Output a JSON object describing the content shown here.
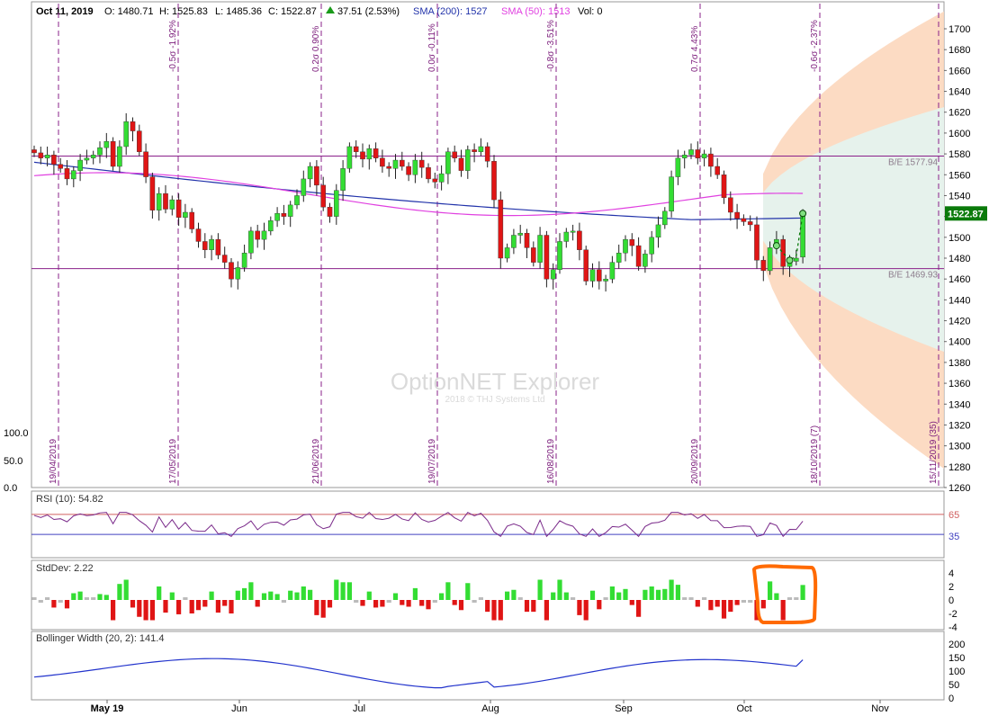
{
  "header": {
    "date": "Oct 11, 2019",
    "open": "O: 1480.71",
    "high": "H: 1525.83",
    "low": "L: 1485.36",
    "close": "C: 1522.87",
    "change": "37.51 (2.53%)",
    "sma200": "SMA (200): 1527",
    "sma50": "SMA (50): 1513",
    "vol": "Vol: 0"
  },
  "watermark": {
    "title": "OptionNET Explorer",
    "copyright": "2018 © THJ Systems Ltd"
  },
  "colors": {
    "up": "#33dd33",
    "down": "#e01515",
    "sma200": "#2233aa",
    "sma50": "#e040e0",
    "cone_outer": "#fbd5b8",
    "cone_inner": "#e5f3ee",
    "expiry": "#8a208a",
    "highlight": "#ff6a00"
  },
  "chart_data": [
    {
      "type": "candlestick",
      "name": "price",
      "y_ticks": [
        "1700",
        "1680",
        "1660",
        "1640",
        "1620",
        "1600",
        "1580",
        "1560",
        "1540",
        "1520",
        "1500",
        "1480",
        "1460",
        "1440",
        "1420",
        "1400",
        "1380",
        "1360",
        "1340",
        "1320",
        "1300",
        "1280",
        "1260"
      ],
      "ylim": [
        1260,
        1710
      ],
      "x_month_labels": [
        "May 19",
        "Jun",
        "Jul",
        "Aug",
        "Sep",
        "Oct",
        "Nov"
      ],
      "last_price_label": "1522.87",
      "breakeven_lines": [
        {
          "label": "B/E 1577.94",
          "value": 1577.94
        },
        {
          "label": "B/E 1469.93",
          "value": 1469.93
        }
      ],
      "expirations": [
        {
          "date": "19/04/2019",
          "move": ""
        },
        {
          "date": "17/05/2019",
          "move": "-0.5σ -1.92%"
        },
        {
          "date": "21/06/2019",
          "move": "0.2σ 0.90%"
        },
        {
          "date": "19/07/2019",
          "move": "0.0σ -0.11%"
        },
        {
          "date": "16/08/2019",
          "move": "-0.8σ -3.51%"
        },
        {
          "date": "20/09/2019",
          "move": "0.7σ 4.43%"
        },
        {
          "date": "18/10/2019 (7)",
          "move": "-0.6σ -2.37%"
        },
        {
          "date": "15/11/2019 (35)",
          "move": ""
        }
      ],
      "left_scale_labels": [
        "100.0",
        "50.0",
        "0.0"
      ],
      "closes": [
        1581,
        1576,
        1579,
        1570,
        1566,
        1556,
        1564,
        1574,
        1576,
        1579,
        1586,
        1592,
        1568,
        1587,
        1611,
        1602,
        1582,
        1558,
        1526,
        1542,
        1527,
        1536,
        1519,
        1524,
        1508,
        1496,
        1488,
        1498,
        1483,
        1476,
        1460,
        1471,
        1485,
        1506,
        1498,
        1506,
        1516,
        1523,
        1520,
        1531,
        1540,
        1556,
        1568,
        1550,
        1529,
        1520,
        1545,
        1566,
        1587,
        1582,
        1575,
        1585,
        1576,
        1568,
        1566,
        1574,
        1568,
        1560,
        1574,
        1567,
        1556,
        1553,
        1561,
        1582,
        1576,
        1564,
        1584,
        1582,
        1587,
        1573,
        1536,
        1480,
        1490,
        1502,
        1504,
        1490,
        1476,
        1502,
        1460,
        1469,
        1496,
        1505,
        1506,
        1488,
        1458,
        1469,
        1458,
        1460,
        1476,
        1485,
        1498,
        1492,
        1472,
        1484,
        1500,
        1512,
        1525,
        1558,
        1576,
        1579,
        1584,
        1576,
        1580,
        1568,
        1560,
        1538,
        1524,
        1518,
        1515,
        1512,
        1478,
        1468,
        1490,
        1498,
        1472,
        1477,
        1480,
        1523
      ],
      "opens": [
        1584,
        1581,
        1576,
        1579,
        1570,
        1566,
        1556,
        1564,
        1574,
        1576,
        1579,
        1586,
        1592,
        1568,
        1587,
        1611,
        1602,
        1582,
        1558,
        1526,
        1542,
        1527,
        1536,
        1519,
        1524,
        1508,
        1496,
        1488,
        1498,
        1483,
        1476,
        1460,
        1471,
        1485,
        1506,
        1498,
        1506,
        1516,
        1523,
        1520,
        1531,
        1540,
        1556,
        1568,
        1550,
        1529,
        1520,
        1545,
        1566,
        1587,
        1582,
        1575,
        1585,
        1576,
        1568,
        1566,
        1574,
        1568,
        1560,
        1574,
        1567,
        1556,
        1553,
        1561,
        1582,
        1576,
        1564,
        1584,
        1582,
        1587,
        1573,
        1536,
        1480,
        1490,
        1502,
        1504,
        1490,
        1476,
        1502,
        1460,
        1469,
        1496,
        1505,
        1506,
        1488,
        1458,
        1469,
        1458,
        1460,
        1476,
        1485,
        1498,
        1492,
        1472,
        1484,
        1500,
        1512,
        1525,
        1558,
        1576,
        1579,
        1584,
        1576,
        1580,
        1568,
        1560,
        1538,
        1524,
        1518,
        1515,
        1512,
        1478,
        1468,
        1490,
        1498,
        1472,
        1477,
        1481
      ]
    },
    {
      "type": "line",
      "name": "RSI (10): 54.82",
      "ylabels": [
        "65",
        "35"
      ],
      "levels": [
        65,
        35
      ],
      "last": 54.82
    },
    {
      "type": "bar",
      "name": "StdDev: 2.22",
      "y_ticks": [
        "4",
        "2",
        "0",
        "-2",
        "-4"
      ],
      "ylim": [
        -4.5,
        4.5
      ],
      "last": 2.22
    },
    {
      "type": "line",
      "name": "Bollinger Width (20, 2): 141.4",
      "y_ticks": [
        "200",
        "150",
        "100",
        "50",
        "0"
      ],
      "ylim": [
        0,
        210
      ],
      "last": 141.4
    }
  ]
}
